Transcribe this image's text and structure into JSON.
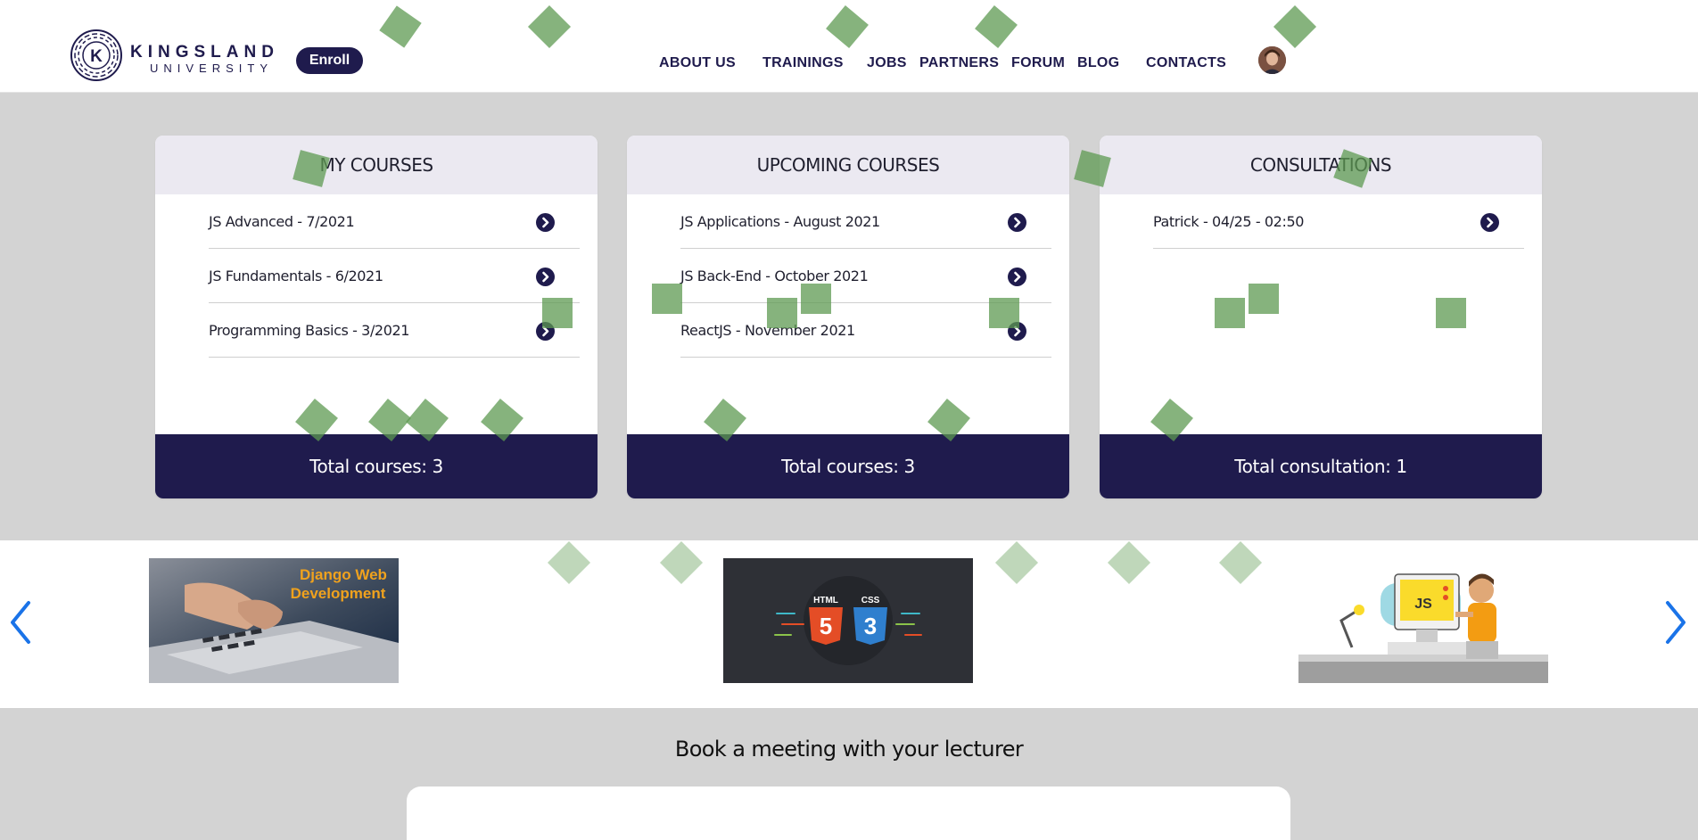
{
  "header": {
    "logo": {
      "title": "KINGSLAND",
      "subtitle": "UNIVERSITY",
      "mark_letter": "K"
    },
    "enroll_label": "Enroll",
    "nav": [
      {
        "label": "ABOUT US"
      },
      {
        "label": "TRAININGS"
      },
      {
        "label": "JOBS"
      },
      {
        "label": "PARTNERS"
      },
      {
        "label": "FORUM"
      },
      {
        "label": "BLOG"
      },
      {
        "label": "CONTACTS"
      }
    ]
  },
  "cards": [
    {
      "title": "MY COURSES",
      "rows": [
        {
          "text": "JS Advanced - 7/2021"
        },
        {
          "text": "JS Fundamentals - 6/2021"
        },
        {
          "text": "Programming Basics - 3/2021"
        }
      ],
      "footer": "Total courses: 3"
    },
    {
      "title": "UPCOMING COURSES",
      "rows": [
        {
          "text": "JS Applications - August 2021"
        },
        {
          "text": "JS Back-End - October 2021"
        },
        {
          "text": "ReactJS - November 2021"
        }
      ],
      "footer": "Total courses: 3"
    },
    {
      "title": "CONSULTATIONS",
      "rows": [
        {
          "text": "Patrick - 04/25 - 02:50"
        }
      ],
      "footer": "Total consultation: 1"
    }
  ],
  "carousel": {
    "slides": [
      {
        "title_line1": "Django Web",
        "title_line2": "Development"
      },
      {
        "html_label": "HTML",
        "html_number": "5",
        "css_label": "CSS",
        "css_number": "3"
      },
      {
        "badge": "JS"
      }
    ]
  },
  "booking": {
    "title": "Book a meeting with your lecturer"
  },
  "colors": {
    "brand_navy": "#1f1b4d",
    "card_header": "#ebe9f1",
    "page_bg": "#d3d3d3",
    "confetti_green": "#5e9a52",
    "carousel_arrow_blue": "#1a73e8"
  },
  "icons": {
    "row_arrow": "chevron-circle-right-icon",
    "carousel_prev": "chevron-left-icon",
    "carousel_next": "chevron-right-icon"
  }
}
